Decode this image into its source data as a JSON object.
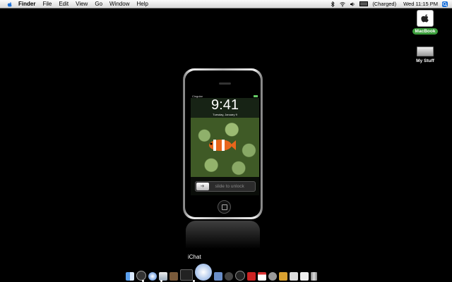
{
  "menubar": {
    "app_name": "Finder",
    "items": [
      "File",
      "Edit",
      "View",
      "Go",
      "Window",
      "Help"
    ],
    "battery_status": "(Charged)",
    "clock": "Wed 11:15 PM"
  },
  "desktop": {
    "icons": [
      {
        "label": "MacBook",
        "icon": "hard-drive-icon",
        "selected": true
      },
      {
        "label": "My Stuff",
        "icon": "folder-icon",
        "selected": false
      }
    ]
  },
  "iphone": {
    "carrier": "Cingular",
    "time": "9:41",
    "date": "Tuesday, January 9",
    "unlock_text": "slide to unlock"
  },
  "dock": {
    "hover_label": "iChat",
    "apps": [
      "finder-icon",
      "dashboard-icon",
      "safari-icon",
      "mail-icon",
      "address-book-icon",
      "ichat-icon",
      "itunes-icon",
      "iphoto-icon",
      "imovie-icon",
      "dvd-player-icon",
      "photo-booth-icon",
      "ical-icon",
      "system-preferences-icon",
      "garageband-icon",
      "preview-icon",
      "textedit-icon",
      "trash-icon"
    ]
  }
}
